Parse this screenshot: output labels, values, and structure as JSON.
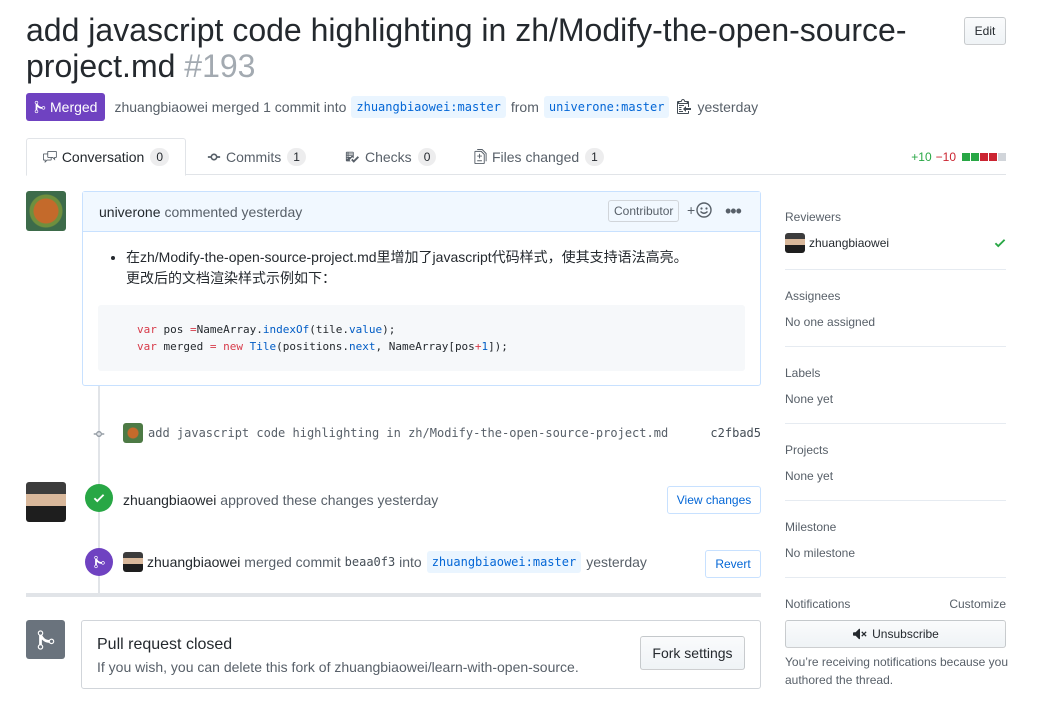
{
  "header": {
    "title": "add javascript code highlighting in zh/Modify-the-open-source-project.md",
    "number": "#193",
    "edit_label": "Edit"
  },
  "meta": {
    "state": "Merged",
    "author": "zhuangbiaowei",
    "action": "merged 1 commit into",
    "base_branch": "zhuangbiaowei:master",
    "from": "from",
    "head_branch": "univerone:master",
    "time": "yesterday"
  },
  "tabs": [
    {
      "label": "Conversation",
      "count": "0",
      "icon": "comment-discussion-icon"
    },
    {
      "label": "Commits",
      "count": "1",
      "icon": "git-commit-icon"
    },
    {
      "label": "Checks",
      "count": "0",
      "icon": "checklist-icon"
    },
    {
      "label": "Files changed",
      "count": "1",
      "icon": "file-diff-icon"
    }
  ],
  "diffstat": {
    "additions": "+10",
    "deletions": "−10",
    "colors": [
      "#28a745",
      "#28a745",
      "#cb2431",
      "#cb2431",
      "#d1d5da"
    ]
  },
  "comment": {
    "author": "univerone",
    "action": "commented yesterday",
    "role": "Contributor",
    "line1": "在zh/Modify-the-open-source-project.md里增加了javascript代码样式，使其支持语法高亮。",
    "line2": "更改后的文档渲染样式示例如下：",
    "code": {
      "l1_var": "var",
      "l1_a": " pos ",
      "l1_eq": "=",
      "l1_b": "NameArray.",
      "l1_fn": "indexOf",
      "l1_c": "(tile.",
      "l1_prop": "value",
      "l1_d": ");",
      "l2_var": "var",
      "l2_a": " merged ",
      "l2_eq": "=",
      "l2_sp": " ",
      "l2_new": "new",
      "l2_sp2": " ",
      "l2_cls": "Tile",
      "l2_b": "(positions.",
      "l2_prop": "next",
      "l2_c": ", NameArray[pos",
      "l2_plus": "+",
      "l2_one": "1",
      "l2_d": "]);"
    }
  },
  "commit": {
    "message": "add javascript code highlighting in zh/Modify-the-open-source-project.md",
    "sha": "c2fbad5"
  },
  "approval": {
    "author": "zhuangbiaowei",
    "action": "approved these changes",
    "time": "yesterday",
    "button": "View changes"
  },
  "merge": {
    "author": "zhuangbiaowei",
    "action": "merged commit",
    "sha": "beaa0f3",
    "into": "into",
    "branch": "zhuangbiaowei:master",
    "time": "yesterday",
    "button": "Revert"
  },
  "closed": {
    "heading": "Pull request closed",
    "text": "If you wish, you can delete this fork of zhuangbiaowei/learn-with-open-source.",
    "button": "Fork settings"
  },
  "sidebar": {
    "reviewers_label": "Reviewers",
    "reviewer": "zhuangbiaowei",
    "assignees_label": "Assignees",
    "assignees_value": "No one assigned",
    "labels_label": "Labels",
    "labels_value": "None yet",
    "projects_label": "Projects",
    "projects_value": "None yet",
    "milestone_label": "Milestone",
    "milestone_value": "No milestone",
    "notifications_label": "Notifications",
    "customize": "Customize",
    "unsubscribe": "Unsubscribe",
    "notif_reason": "You’re receiving notifications because you authored the thread."
  }
}
